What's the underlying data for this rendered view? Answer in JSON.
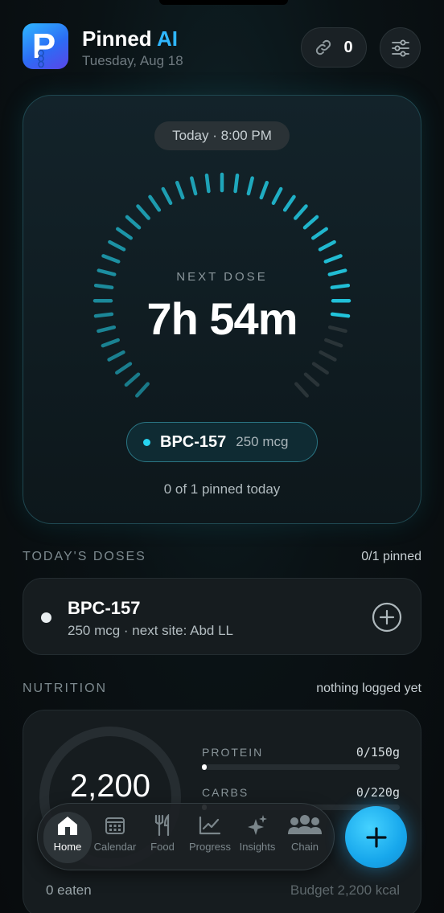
{
  "header": {
    "app_name": "Pinned",
    "app_name_accent": "AI",
    "date": "Tuesday, Aug 18",
    "link_count": "0",
    "accent_color": "#2fb7ff"
  },
  "hero": {
    "when": "Today · 8:00 PM",
    "next_label": "NEXT DOSE",
    "countdown": "7h 54m",
    "dose_name": "BPC-157",
    "dose_amount": "250 mcg",
    "pinned_today": "0 of 1 pinned today",
    "remaining_fraction": 0.33
  },
  "doses": {
    "section_title": "TODAY'S DOSES",
    "summary": "0/1 pinned",
    "items": [
      {
        "name": "BPC-157",
        "detail": "250 mcg · next site: Abd LL"
      }
    ]
  },
  "nutrition": {
    "section_title": "NUTRITION",
    "status": "nothing logged yet",
    "calories": "2,200",
    "macros": [
      {
        "label": "PROTEIN",
        "value": "0/150g",
        "fraction": 0
      },
      {
        "label": "CARBS",
        "value": "0/220g",
        "fraction": 0
      }
    ],
    "eaten": "0 eaten",
    "budget": "Budget 2,200 kcal"
  },
  "nav": {
    "tabs": [
      {
        "label": "Home",
        "icon": "home-icon",
        "active": true
      },
      {
        "label": "Calendar",
        "icon": "calendar-icon"
      },
      {
        "label": "Food",
        "icon": "fork-knife-icon"
      },
      {
        "label": "Progress",
        "icon": "chart-icon"
      },
      {
        "label": "Insights",
        "icon": "sparkles-icon"
      },
      {
        "label": "Chain",
        "icon": "people-icon"
      }
    ],
    "fab_icon": "plus-icon"
  }
}
